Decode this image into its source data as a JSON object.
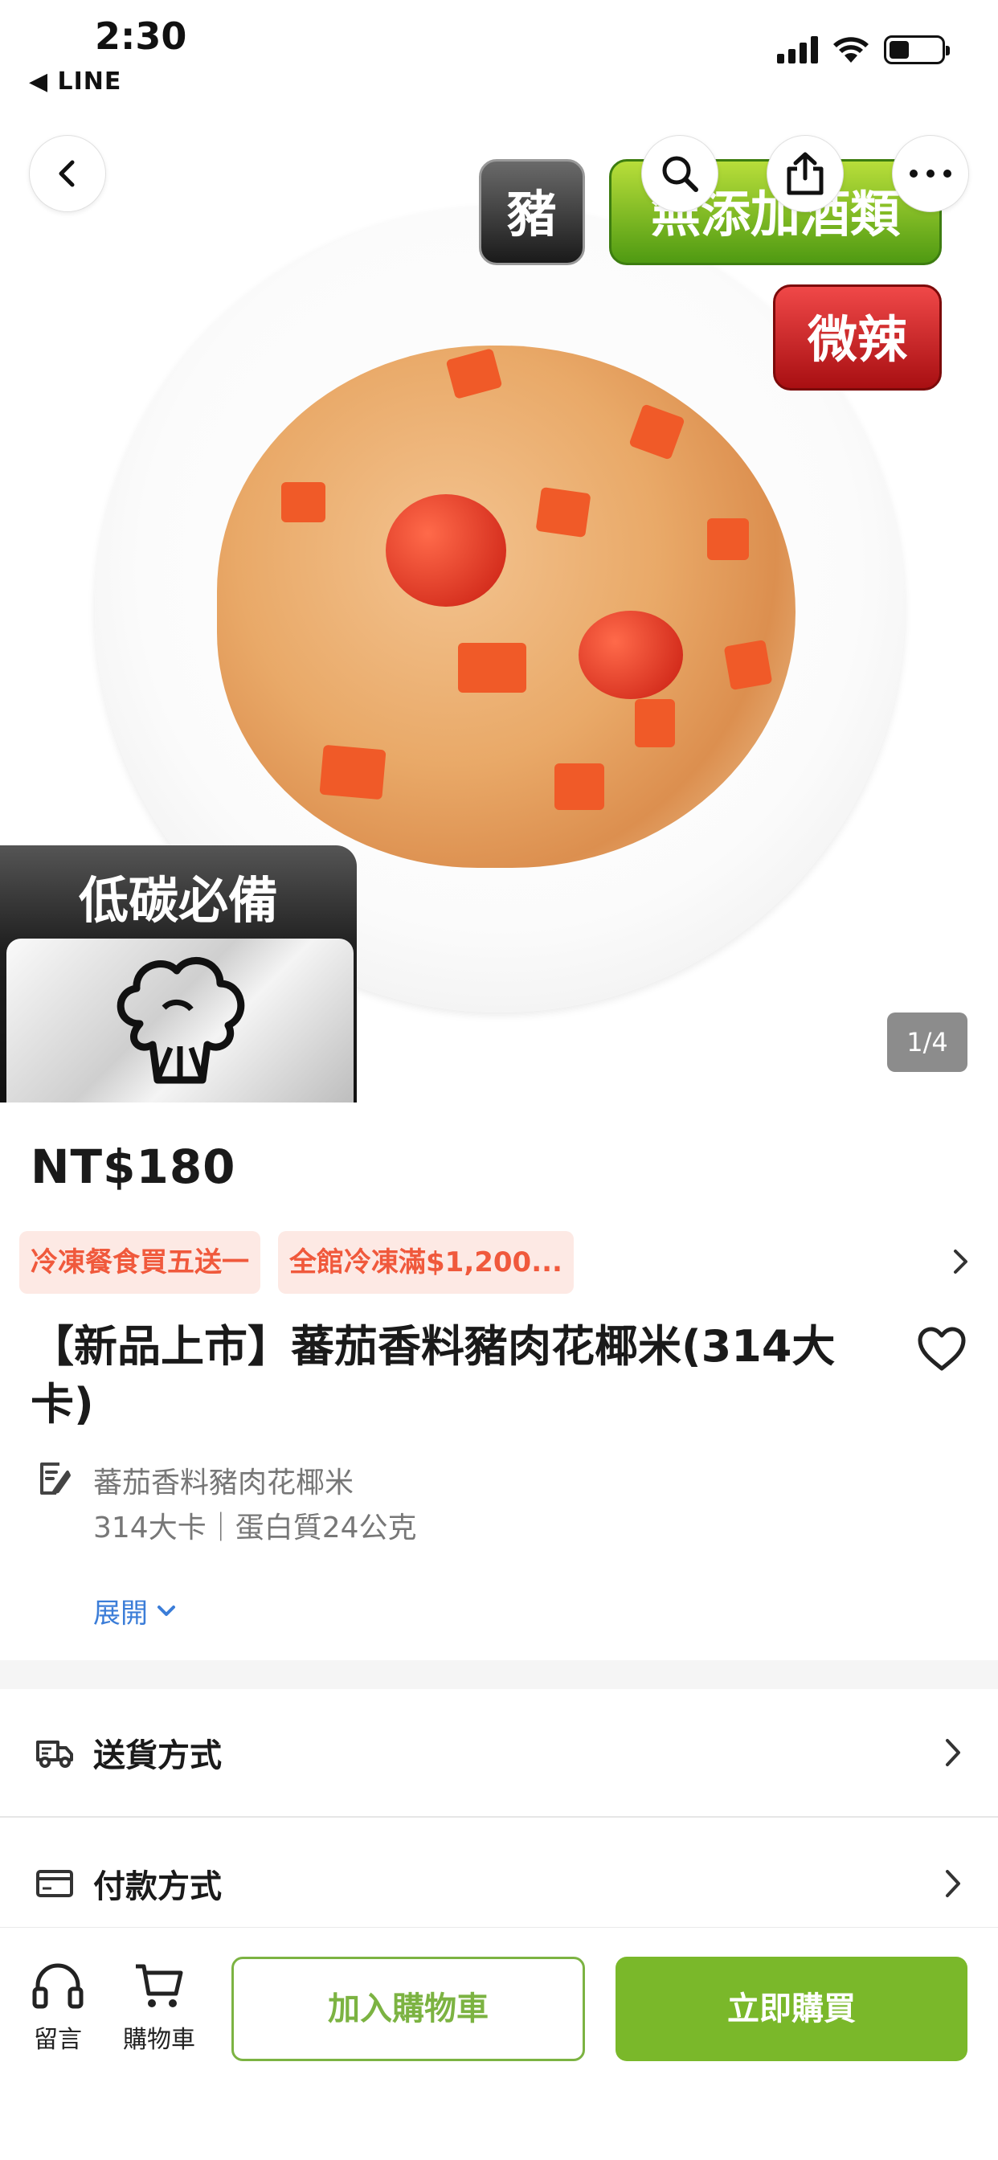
{
  "status_bar": {
    "time": "2:30",
    "back_app": "◀ LINE"
  },
  "hero": {
    "tags": {
      "pork": "豬",
      "no_alcohol": "無添加酒類",
      "spicy": "微辣"
    },
    "low_carb_badge": "低碳必備",
    "image_counter": "1/4"
  },
  "product": {
    "price": "NT$180",
    "promotions": [
      "冷凍餐食買五送一",
      "全館冷凍滿$1,200..."
    ],
    "title": "【新品上市】蕃茄香料豬肉花椰米(314大卡)",
    "description_name": "蕃茄香料豬肉花椰米",
    "description_meta": "314大卡｜蛋白質24公克",
    "expand_label": "展開"
  },
  "info_rows": {
    "delivery_label": "送貨方式",
    "payment_label": "付款方式"
  },
  "bottom_bar": {
    "message_label": "留言",
    "cart_label": "購物車",
    "add_to_cart_label": "加入購物車",
    "buy_now_label": "立即購買"
  },
  "colors": {
    "accent_green": "#7ab82a",
    "promo_red": "#f0593c",
    "link_blue": "#3b7dd8"
  }
}
